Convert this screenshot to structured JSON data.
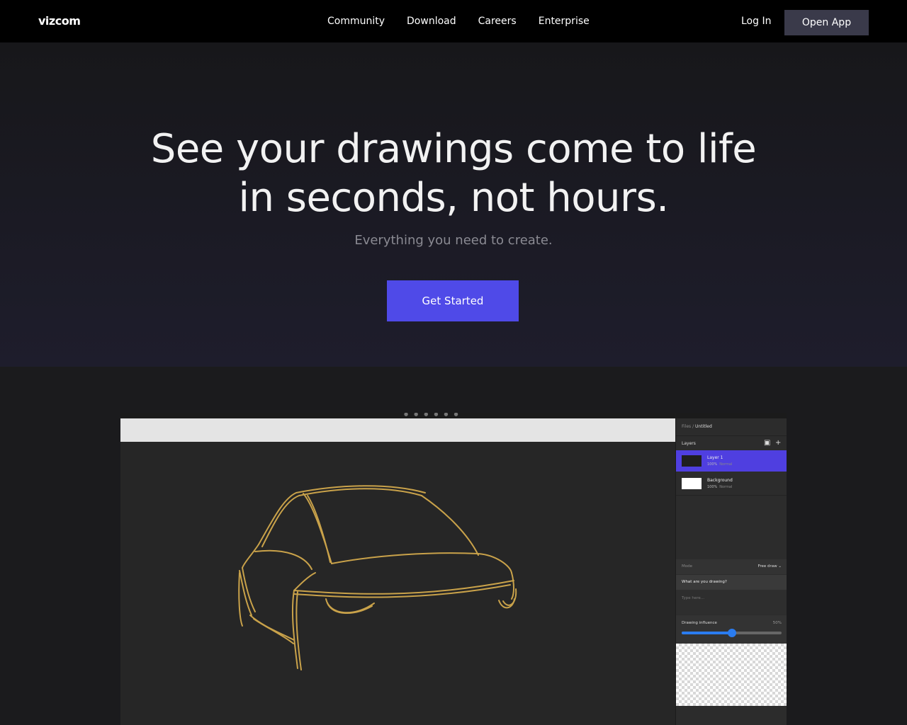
{
  "nav": {
    "logo": "vizcom",
    "links": [
      "Community",
      "Download",
      "Careers",
      "Enterprise"
    ],
    "login": "Log In",
    "open_app": "Open App"
  },
  "hero": {
    "title_line1": "See your drawings come to life",
    "title_line2": "in seconds, not hours.",
    "subtitle": "Everything you need to create.",
    "cta": "Get Started"
  },
  "preview": {
    "breadcrumb_root": "Files /",
    "breadcrumb_file": "Untitled",
    "layers_label": "Layers",
    "layers": [
      {
        "name": "Layer 1",
        "opacity": "100%",
        "blend": "Normal",
        "active": true
      },
      {
        "name": "Background",
        "opacity": "100%",
        "blend": "Normal",
        "active": false
      }
    ],
    "mode_label": "Mode",
    "mode_value": "Free draw",
    "prompt_label": "What are you drawing?",
    "prompt_placeholder": "Type here...",
    "influence_label": "Drawing influence",
    "influence_value": "50%",
    "influence_fraction": 0.5
  },
  "colors": {
    "accent": "#4f4ae8",
    "active_layer": "#4f3fe0",
    "slider": "#2a7cf0",
    "sketch_stroke": "#c9a24a"
  }
}
